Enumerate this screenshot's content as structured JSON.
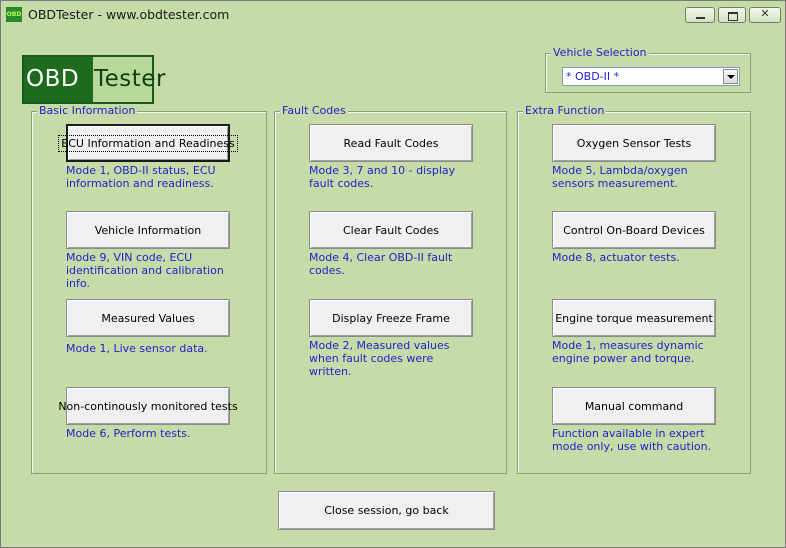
{
  "window": {
    "title": "OBDTester - www.obdtester.com"
  },
  "logo": {
    "part1": "OBD",
    "part2": "Tester"
  },
  "vehicle_selection": {
    "label": "Vehicle Selection",
    "selected": "* OBD-II *"
  },
  "groups": {
    "basic": {
      "label": "Basic Information",
      "items": [
        {
          "button": "ECU Information and Readiness",
          "desc": "Mode 1, OBD-II status, ECU information and readiness."
        },
        {
          "button": "Vehicle Information",
          "desc": "Mode 9, VIN code, ECU identification and calibration info."
        },
        {
          "button": "Measured Values",
          "desc": "Mode 1, Live sensor data."
        },
        {
          "button": "Non-continously monitored tests",
          "desc": "Mode 6, Perform tests."
        }
      ]
    },
    "fault": {
      "label": "Fault Codes",
      "items": [
        {
          "button": "Read Fault Codes",
          "desc": "Mode 3, 7 and 10 - display fault codes."
        },
        {
          "button": "Clear Fault Codes",
          "desc": "Mode 4, Clear OBD-II fault codes."
        },
        {
          "button": "Display Freeze Frame",
          "desc": "Mode 2, Measured values when fault codes were written."
        }
      ]
    },
    "extra": {
      "label": "Extra Function",
      "items": [
        {
          "button": "Oxygen Sensor Tests",
          "desc": "Mode 5, Lambda/oxygen sensors measurement."
        },
        {
          "button": "Control On-Board Devices",
          "desc": "Mode 8, actuator tests."
        },
        {
          "button": "Engine torque measurement",
          "desc": "Mode 1, measures dynamic engine power and torque."
        },
        {
          "button": "Manual command",
          "desc": "Function available in expert mode only, use with caution."
        }
      ]
    }
  },
  "close_button": "Close session, go back"
}
